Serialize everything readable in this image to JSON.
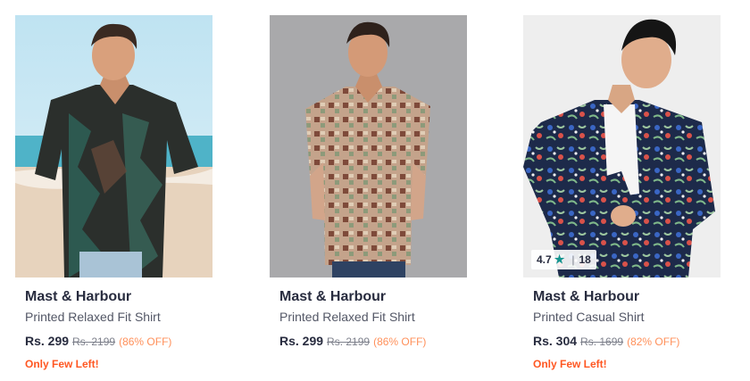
{
  "products": [
    {
      "brand": "Mast & Harbour",
      "name": "Printed Relaxed Fit Shirt",
      "price": "Rs. 299",
      "mrp": "Rs. 2199",
      "discount": "(86% OFF)",
      "stock_note": "Only Few Left!"
    },
    {
      "brand": "Mast & Harbour",
      "name": "Printed Relaxed Fit Shirt",
      "price": "Rs. 299",
      "mrp": "Rs. 2199",
      "discount": "(86% OFF)",
      "stock_note": ""
    },
    {
      "brand": "Mast & Harbour",
      "name": "Printed Casual Shirt",
      "price": "Rs. 304",
      "mrp": "Rs. 1699",
      "discount": "(82% OFF)",
      "stock_note": "Only Few Left!",
      "rating": {
        "value": "4.7",
        "count": "18",
        "icon": "star-icon"
      }
    }
  ],
  "colors": {
    "accent_teal": "#14958f",
    "discount": "#ff905a",
    "few_left": "#ff5722",
    "text_dark": "#282c3f"
  }
}
